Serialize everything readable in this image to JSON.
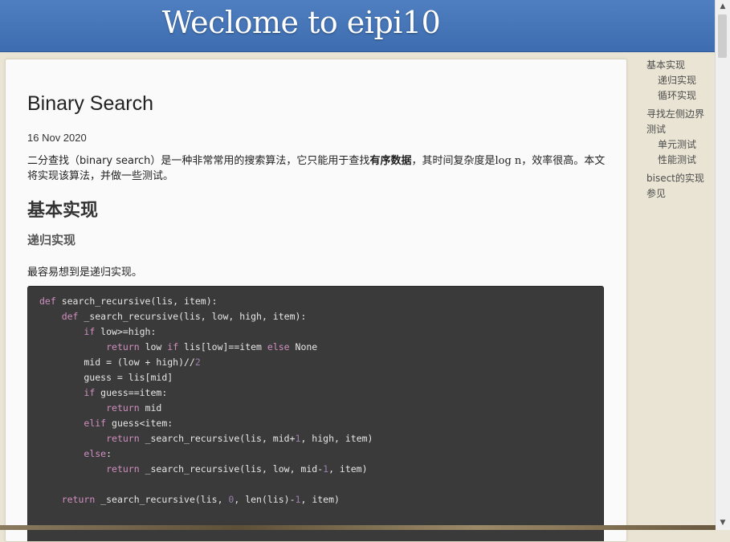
{
  "banner": {
    "title": "Weclome to eipi10"
  },
  "post": {
    "title": "Binary Search",
    "date": "16 Nov 2020",
    "intro_part1": "二分查找（binary search）是一种非常常用的搜索算法，它只能用于查找",
    "intro_bold": "有序数据",
    "intro_part2": "，其时间复杂度是",
    "intro_math": "log n",
    "intro_part3": "，效率很高。本文将实现该算法，并做一些测试。",
    "h2": "基本实现",
    "h3": "递归实现",
    "para": "最容易想到是递归实现。"
  },
  "code": {
    "lines": [
      [
        [
          "k",
          "def"
        ],
        [
          "t",
          " search_recursive(lis, item):"
        ]
      ],
      [
        [
          "t",
          "    "
        ],
        [
          "k",
          "def"
        ],
        [
          "t",
          " _search_recursive(lis, low, high, item):"
        ]
      ],
      [
        [
          "t",
          "        "
        ],
        [
          "k",
          "if"
        ],
        [
          "t",
          " low>=high:"
        ]
      ],
      [
        [
          "t",
          "            "
        ],
        [
          "k",
          "return"
        ],
        [
          "t",
          " low "
        ],
        [
          "k",
          "if"
        ],
        [
          "t",
          " lis[low]==item "
        ],
        [
          "k",
          "else"
        ],
        [
          "t",
          " None"
        ]
      ],
      [
        [
          "t",
          "        mid = (low + high)//"
        ],
        [
          "n",
          "2"
        ]
      ],
      [
        [
          "t",
          "        guess = lis[mid]"
        ]
      ],
      [
        [
          "t",
          "        "
        ],
        [
          "k",
          "if"
        ],
        [
          "t",
          " guess==item:"
        ]
      ],
      [
        [
          "t",
          "            "
        ],
        [
          "k",
          "return"
        ],
        [
          "t",
          " mid"
        ]
      ],
      [
        [
          "t",
          "        "
        ],
        [
          "k",
          "elif"
        ],
        [
          "t",
          " guess<item:"
        ]
      ],
      [
        [
          "t",
          "            "
        ],
        [
          "k",
          "return"
        ],
        [
          "t",
          " _search_recursive(lis, mid+"
        ],
        [
          "n",
          "1"
        ],
        [
          "t",
          ", high, item)"
        ]
      ],
      [
        [
          "t",
          "        "
        ],
        [
          "k",
          "else"
        ],
        [
          "t",
          ":"
        ]
      ],
      [
        [
          "t",
          "            "
        ],
        [
          "k",
          "return"
        ],
        [
          "t",
          " _search_recursive(lis, low, mid-"
        ],
        [
          "n",
          "1"
        ],
        [
          "t",
          ", item)"
        ]
      ],
      [
        [
          "t",
          ""
        ]
      ],
      [
        [
          "t",
          "    "
        ],
        [
          "k",
          "return"
        ],
        [
          "t",
          " _search_recursive(lis, "
        ],
        [
          "n",
          "0"
        ],
        [
          "t",
          ", len(lis)-"
        ],
        [
          "n",
          "1"
        ],
        [
          "t",
          ", item)"
        ]
      ]
    ]
  },
  "toc": {
    "items": [
      {
        "label": "基本实现",
        "level": 1
      },
      {
        "label": "递归实现",
        "level": 2
      },
      {
        "label": "循环实现",
        "level": 2
      },
      {
        "label": "寻找左侧边界",
        "level": 1,
        "gap": true
      },
      {
        "label": "测试",
        "level": 1
      },
      {
        "label": "单元测试",
        "level": 2
      },
      {
        "label": "性能测试",
        "level": 2
      },
      {
        "label": "bisect的实现",
        "level": 1,
        "gap": true
      },
      {
        "label": "参见",
        "level": 1
      }
    ]
  },
  "scrollbar": {
    "up_icon": "▲",
    "down_icon": "▼"
  }
}
